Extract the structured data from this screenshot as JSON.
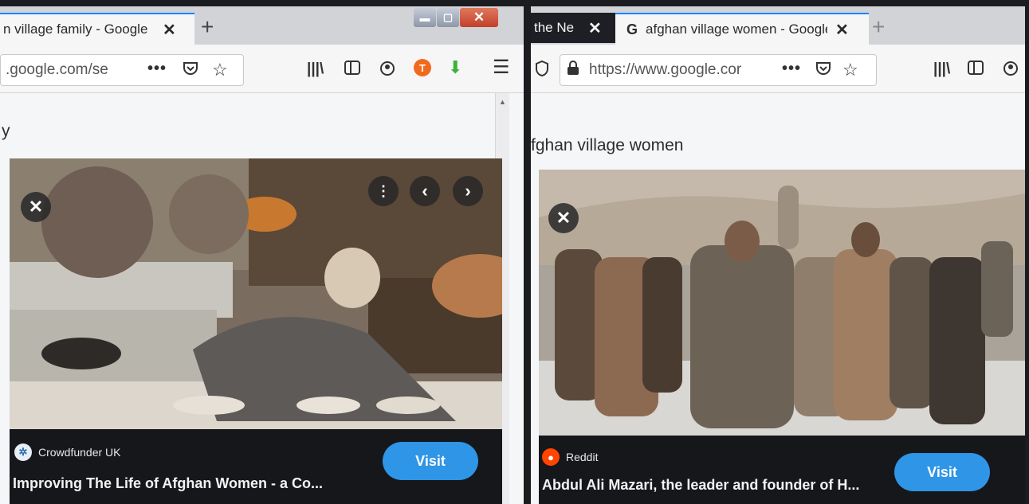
{
  "left": {
    "tab_title": "n village family - Google",
    "url": ".google.com/se",
    "query": "y",
    "card": {
      "source": "Crowdfunder UK",
      "caption": "Improving The Life of Afghan Women - a Co...",
      "visit": "Visit"
    },
    "icons": [
      "close-icon",
      "new-tab-icon",
      "minimize-icon",
      "maximize-icon",
      "close-window-icon",
      "more-actions-icon",
      "pocket-icon",
      "bookmark-star-icon",
      "library-icon",
      "sidebar-icon",
      "account-icon",
      "extension-icon",
      "download-icon",
      "menu-icon",
      "previous-icon",
      "next-icon"
    ]
  },
  "right": {
    "tab_prev": "the Ne",
    "tab_title": "afghan village women - Google",
    "url": "https://www.google.cor",
    "query": "fghan village women",
    "card": {
      "source": "Reddit",
      "caption": "Abdul Ali Mazari, the leader and founder of H...",
      "visit": "Visit"
    },
    "icons": [
      "shield-icon",
      "lock-icon",
      "google-icon",
      "reddit-icon"
    ]
  },
  "colors": {
    "accent": "#0a84ff",
    "visit_button": "#2f95e6",
    "card_bg": "#16171b"
  }
}
